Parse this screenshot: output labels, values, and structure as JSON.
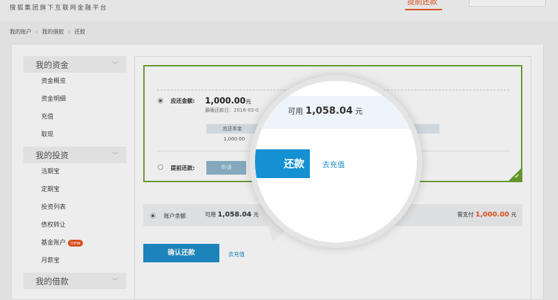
{
  "header": {
    "logo_tagline": "搜狐集团旗下互联网金融平台",
    "nav": [
      "",
      "",
      "",
      "",
      "提前还款"
    ]
  },
  "breadcrumb": [
    "我的账户",
    "我的借款",
    "还款"
  ],
  "sidebar": {
    "sections": [
      {
        "title": "我的资金",
        "items": [
          "资金概览",
          "资金明细",
          "充值",
          "取现"
        ]
      },
      {
        "title": "我的投资",
        "items": [
          "活期宝",
          "定期宝",
          "投资列表",
          "债权转让",
          "基金账户",
          "月薪宝"
        ]
      },
      {
        "title": "我的借款",
        "items": []
      }
    ],
    "new_badge": "new"
  },
  "repay": {
    "due_label": "应还金额:",
    "due_amount": "1,000.00",
    "unit": "元",
    "last_date": "最晚还款日：2016-03-0",
    "col_head": "应还本金",
    "col_value": "1,000.00",
    "early_label": "提前还款:",
    "apply_button": "申请"
  },
  "balance": {
    "label": "账户余额",
    "available_prefix": "可用",
    "available_amount": "1,058.04",
    "unit": "元",
    "need_prefix": "需支付",
    "need_amount": "1,000.00"
  },
  "actions": {
    "confirm_button": "确认还款",
    "recharge_link": "去充值"
  },
  "magnifier": {
    "available_prefix": "可用",
    "available_amount": "1,058.04",
    "unit": "元",
    "button_text": "还款",
    "recharge_link": "去充值"
  },
  "colors": {
    "accent": "#e8541e",
    "primary_blue": "#1f8ec9",
    "success_green": "#6aa12f"
  }
}
